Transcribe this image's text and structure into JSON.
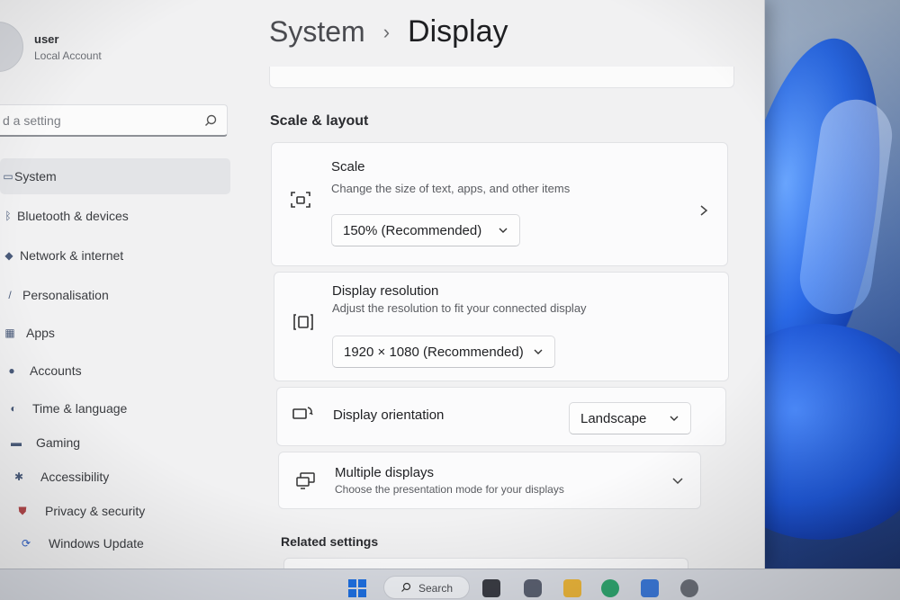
{
  "profile": {
    "name": "user",
    "account_type": "Local Account"
  },
  "search": {
    "placeholder": "d a setting"
  },
  "sidebar": {
    "items": [
      {
        "label": "System",
        "icon": "monitor-icon",
        "active": true
      },
      {
        "label": "Bluetooth & devices",
        "icon": "bluetooth-icon"
      },
      {
        "label": "Network & internet",
        "icon": "wifi-icon"
      },
      {
        "label": "Personalisation",
        "icon": "brush-icon"
      },
      {
        "label": "Apps",
        "icon": "apps-icon"
      },
      {
        "label": "Accounts",
        "icon": "person-icon"
      },
      {
        "label": "Time & language",
        "icon": "globe-clock-icon"
      },
      {
        "label": "Gaming",
        "icon": "gamepad-icon"
      },
      {
        "label": "Accessibility",
        "icon": "accessibility-icon"
      },
      {
        "label": "Privacy & security",
        "icon": "shield-icon"
      },
      {
        "label": "Windows Update",
        "icon": "update-icon"
      }
    ]
  },
  "header": {
    "parent": "System",
    "separator": "›",
    "current": "Display"
  },
  "main": {
    "section_title": "Scale & layout",
    "scale": {
      "title": "Scale",
      "subtitle": "Change the size of text, apps, and other items",
      "value": "150% (Recommended)"
    },
    "resolution": {
      "title": "Display resolution",
      "subtitle": "Adjust the resolution to fit your connected display",
      "value": "1920 × 1080 (Recommended)"
    },
    "orientation": {
      "title": "Display orientation",
      "value": "Landscape"
    },
    "multiple": {
      "title": "Multiple displays",
      "subtitle": "Choose the presentation mode for your displays"
    },
    "related_title": "Related settings"
  },
  "taskbar": {
    "search_label": "Search"
  },
  "colors": {
    "window_bg": "#f1f1f2",
    "card_bg": "#fbfbfc",
    "accent": "#1f58d8"
  }
}
